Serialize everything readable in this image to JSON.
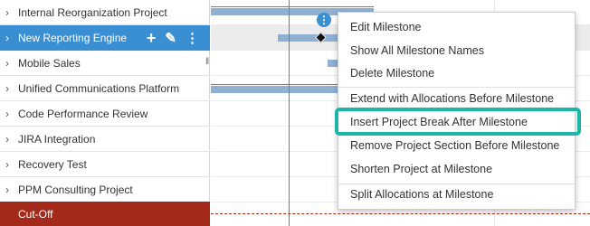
{
  "projects": [
    {
      "label": "Internal Reorganization Project",
      "chevron": "›"
    },
    {
      "label": "New Reporting Engine",
      "chevron": "›"
    },
    {
      "label": "Mobile Sales",
      "chevron": "›"
    },
    {
      "label": "Unified Communications Platform",
      "chevron": "›"
    },
    {
      "label": "Code Performance Review",
      "chevron": "›"
    },
    {
      "label": "JIRA Integration",
      "chevron": "›"
    },
    {
      "label": "Recovery Test",
      "chevron": "›"
    },
    {
      "label": "PPM Consulting Project",
      "chevron": "›"
    }
  ],
  "selected_row_actions": {
    "add": "+",
    "edit": "✎",
    "more": "⋮"
  },
  "cutoff": {
    "label": "Cut-Off"
  },
  "milestone_badge": "⋮",
  "resize_glyph": "‖",
  "context_menu": {
    "items": [
      "Edit Milestone",
      "Show All Milestone Names",
      "Delete Milestone",
      "Extend with Allocations Before Milestone",
      "Insert Project Break After Milestone",
      "Remove Project Section Before Milestone",
      "Shorten Project at Milestone",
      "Split Allocations at Milestone"
    ],
    "highlighted_index": 4
  },
  "colors": {
    "selected_row": "#3a8fd3",
    "cutoff_row": "#a32a1a",
    "bar": "#8fb0d1",
    "today_line": "#d9534f",
    "highlight": "#1cb6a8"
  }
}
